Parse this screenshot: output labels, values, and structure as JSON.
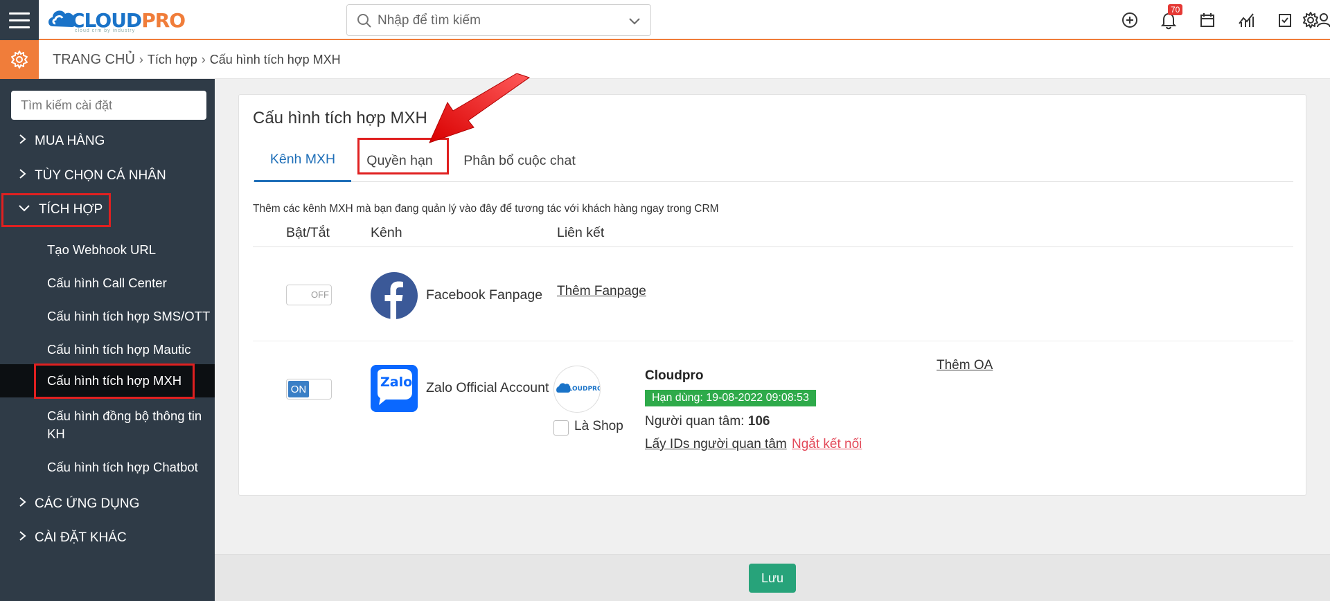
{
  "app": {
    "logo_main": "CLOUD",
    "logo_accent": "PRO",
    "logo_tagline": "cloud crm by industry"
  },
  "header": {
    "search_placeholder": "Nhập để tìm kiếm",
    "notifications_count": "70",
    "icons": [
      "add-circle-icon",
      "bell-icon",
      "calendar-icon",
      "chart-icon",
      "task-check-icon",
      "user-icon",
      "settings-gear-icon"
    ]
  },
  "breadcrumb": {
    "home": "TRANG CHỦ",
    "level1": "Tích hợp",
    "level2": "Cấu hình tích hợp MXH"
  },
  "sidebar": {
    "search_placeholder": "Tìm kiếm cài đặt",
    "sections": [
      {
        "label": "MUA HÀNG",
        "expanded": false
      },
      {
        "label": "TÙY CHỌN CÁ NHÂN",
        "expanded": false
      },
      {
        "label": "TÍCH HỢP",
        "expanded": true
      },
      {
        "label": "CÁC ỨNG DỤNG",
        "expanded": false
      },
      {
        "label": "CÀI ĐẶT KHÁC",
        "expanded": false
      }
    ],
    "sub_items": [
      "Tạo Webhook URL",
      "Cấu hình Call Center",
      "Cấu hình tích hợp SMS/OTT",
      "Cấu hình tích hợp Mautic",
      "Cấu hình tích hợp MXH",
      "Cấu hình đồng bộ thông tin KH",
      "Cấu hình tích hợp Chatbot"
    ],
    "active_sub_item": "Cấu hình tích hợp MXH"
  },
  "main": {
    "title": "Cấu hình tích hợp MXH",
    "tabs": [
      {
        "label": "Kênh MXH",
        "active": true
      },
      {
        "label": "Quyền hạn",
        "active": false
      },
      {
        "label": "Phân bổ cuộc chat",
        "active": false
      }
    ],
    "description": "Thêm các kênh MXH mà bạn đang quản lý vào đây để tương tác với khách hàng ngay trong CRM",
    "columns": [
      "Bật/Tắt",
      "Kênh",
      "Liên kết"
    ],
    "rows": [
      {
        "toggle": "OFF",
        "channel": "Facebook Fanpage",
        "add_link": "Thêm Fanpage"
      },
      {
        "toggle": "ON",
        "channel": "Zalo Official Account",
        "account_logo_text": "CLOUDPRO",
        "account_name": "Cloudpro",
        "expiry": "Hạn dùng: 19-08-2022 09:08:53",
        "followers_label": "Người quan tâm:",
        "followers_count": "106",
        "get_ids_link": "Lấy IDs người quan tâm",
        "disconnect_link": "Ngắt kết nối",
        "is_shop_label": "Là Shop",
        "add_link": "Thêm OA",
        "zalo_logo_text": "Zalo"
      }
    ]
  },
  "footer": {
    "save_label": "Lưu"
  },
  "colors": {
    "accent_orange": "#f07d3a",
    "sidebar_bg": "#2f3b47",
    "tab_active": "#1f6fb8",
    "save_green": "#27a37a",
    "expiry_green": "#2eaa4a",
    "disconnect_red": "#e34a5a",
    "highlight_red": "#e02020"
  }
}
